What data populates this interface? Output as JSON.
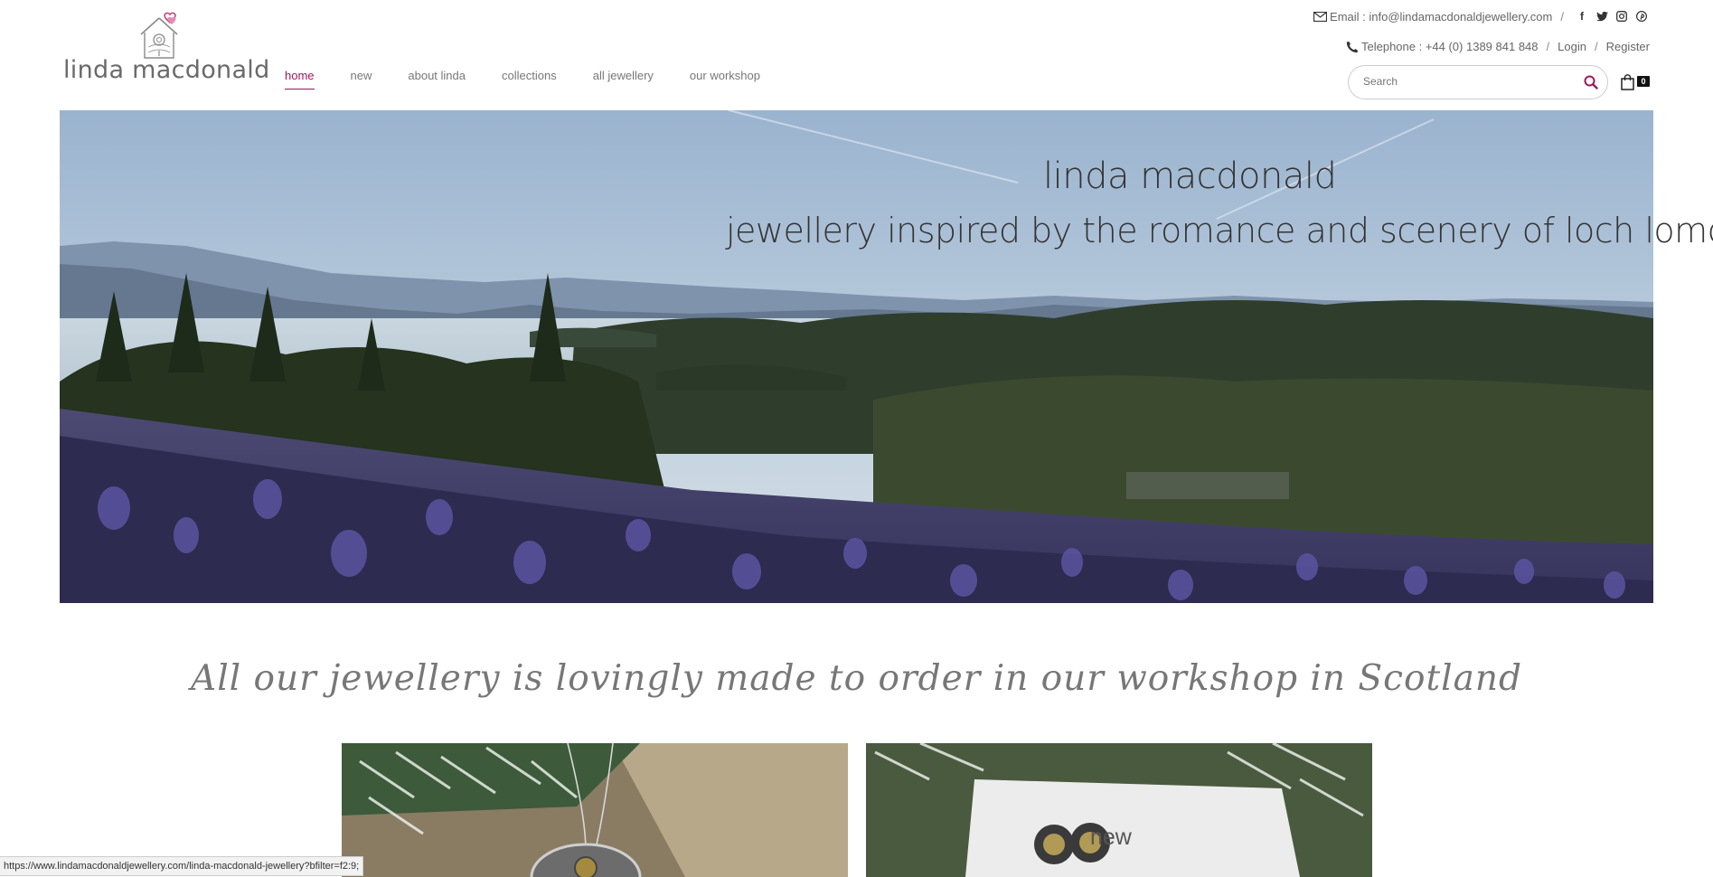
{
  "topbar": {
    "email_text": "Email : info@lindamacdonaldjewellery.com",
    "telephone_text": "Telephone : +44 (0) 1389 841 848",
    "login_label": "Login",
    "register_label": "Register",
    "separator": "/",
    "social_icons": [
      "facebook-icon",
      "twitter-icon",
      "instagram-icon",
      "pinterest-icon"
    ]
  },
  "logo": {
    "text": "linda macdonald"
  },
  "nav": {
    "items": [
      {
        "label": "home",
        "active": true
      },
      {
        "label": "new"
      },
      {
        "label": "about linda"
      },
      {
        "label": "collections"
      },
      {
        "label": "all jewellery"
      },
      {
        "label": "our workshop"
      }
    ]
  },
  "search": {
    "placeholder": "Search"
  },
  "cart": {
    "count": "0"
  },
  "hero": {
    "title": "linda macdonald",
    "subtitle": "jewellery inspired by the romance and scenery of loch lomond"
  },
  "tagline": "All our jewellery is lovingly made to order in our workshop in Scotland",
  "tiles": {
    "second_label": "new"
  },
  "status_bar": {
    "url": "https://www.lindamacdonaldjewellery.com/linda-macdonald-jewellery?bfilter=f2:9;"
  },
  "colors": {
    "accent": "#a0175c",
    "text": "#555555"
  }
}
